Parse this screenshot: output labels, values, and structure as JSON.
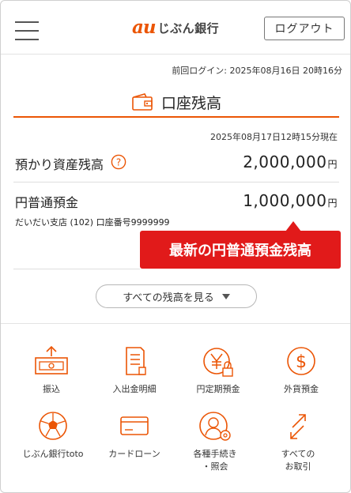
{
  "header": {
    "logo_mark": "au",
    "logo_text": "じぶん銀行",
    "logout_label": "ログアウト"
  },
  "last_login": "前回ログイン: 2025年08月16日 20時16分",
  "account_balance": {
    "title": "口座残高",
    "as_of": "2025年08月17日12時15分現在",
    "total_assets_label": "預かり資産残高",
    "total_assets_amount": "2,000,000",
    "currency_unit": "円",
    "ordinary_deposit_label": "円普通預金",
    "ordinary_deposit_amount": "1,000,000",
    "branch_info": "だいだい支店 (102) 口座番号9999999",
    "callout": "最新の円普通預金残高",
    "show_all_label": "すべての残高を見る"
  },
  "menu": {
    "items": [
      {
        "label": "振込",
        "icon": "transfer-icon"
      },
      {
        "label": "入出金明細",
        "icon": "statement-icon"
      },
      {
        "label": "円定期預金",
        "icon": "yen-time-deposit-icon"
      },
      {
        "label": "外貨預金",
        "icon": "foreign-currency-icon"
      },
      {
        "label": "じぶん銀行toto",
        "icon": "soccer-ball-icon"
      },
      {
        "label": "カードローン",
        "icon": "card-icon"
      },
      {
        "label": "各種手続き\n・照会",
        "icon": "person-gear-icon"
      },
      {
        "label": "すべての\nお取引",
        "icon": "exchange-arrows-icon"
      }
    ]
  },
  "colors": {
    "accent": "#eb5505",
    "callout": "#e11a1a"
  }
}
